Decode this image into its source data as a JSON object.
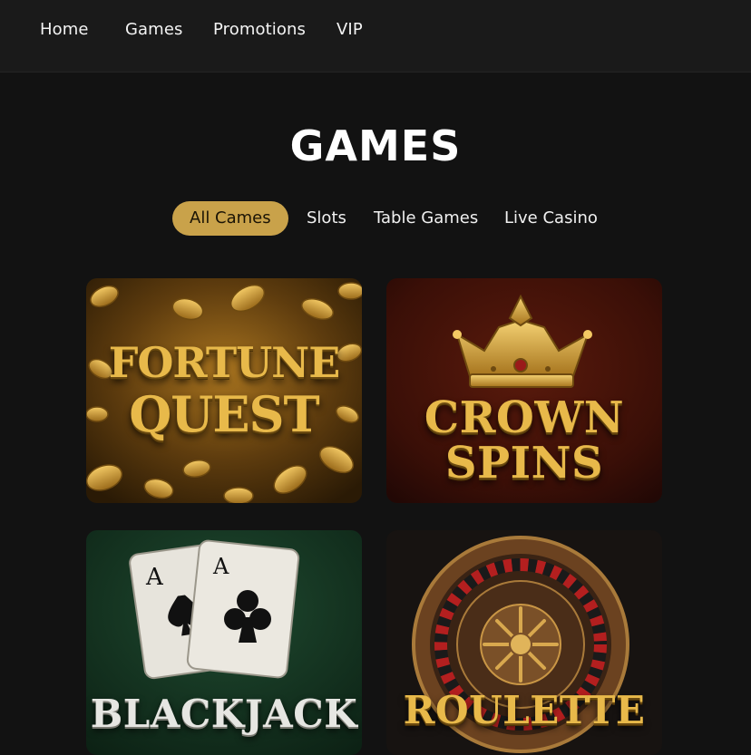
{
  "nav": {
    "items": [
      {
        "label": "Home"
      },
      {
        "label": "Games"
      },
      {
        "label": "Promotions"
      },
      {
        "label": "VIP"
      }
    ]
  },
  "page": {
    "title": "GAMES"
  },
  "filters": {
    "items": [
      {
        "label": "All Cames",
        "active": true
      },
      {
        "label": "Slots",
        "active": false
      },
      {
        "label": "Table Games",
        "active": false
      },
      {
        "label": "Live Casino",
        "active": false
      }
    ]
  },
  "games": [
    {
      "title_line1": "FORTUNE",
      "title_line2": "QUEST",
      "theme": "gold-coins"
    },
    {
      "title_line1": "CROWN",
      "title_line2": "SPINS",
      "theme": "crown"
    },
    {
      "title_line1": "BLACKJACK",
      "theme": "ace-cards"
    },
    {
      "title_line1": "ROULETTE",
      "theme": "roulette-wheel"
    }
  ],
  "colors": {
    "background": "#121212",
    "navbar": "#1a1a1a",
    "accent_gold": "#c9a24a"
  }
}
